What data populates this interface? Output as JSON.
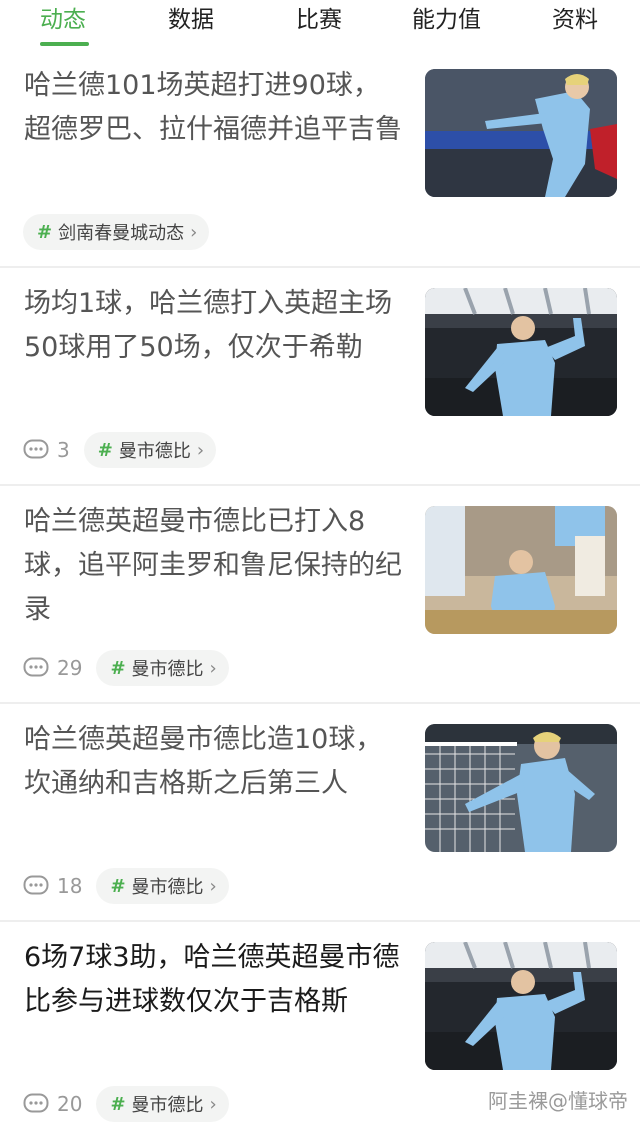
{
  "tabs": [
    "动态",
    "数据",
    "比赛",
    "能力值",
    "资料"
  ],
  "active_tab": 0,
  "colors": {
    "accent": "#4caf50",
    "city_blue": "#6cabdd",
    "comment_grey": "#999999"
  },
  "articles": [
    {
      "title": "哈兰德101场英超打进90球，超德罗巴、拉什福德并追平吉鲁",
      "comments": "",
      "tag": "剑南春曼城动态"
    },
    {
      "title": "场均1球，哈兰德打入英超主场50球用了50场，仅次于希勒",
      "comments": "3",
      "tag": "曼市德比"
    },
    {
      "title": "哈兰德英超曼市德比已打入8球，追平阿圭罗和鲁尼保持的纪录",
      "comments": "29",
      "tag": "曼市德比"
    },
    {
      "title": "哈兰德英超曼市德比造10球，坎通纳和吉格斯之后第三人",
      "comments": "18",
      "tag": "曼市德比"
    },
    {
      "title": "6场7球3助，哈兰德英超曼市德比参与进球数仅次于吉格斯",
      "comments": "20",
      "tag": "曼市德比"
    }
  ],
  "watermark": "阿圭裸@懂球帝"
}
